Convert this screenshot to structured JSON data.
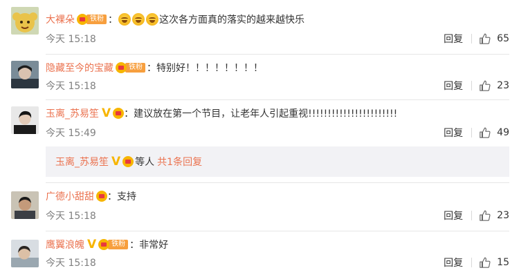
{
  "comments": [
    {
      "user": "大裸朵",
      "badge": "铁粉",
      "emoji_count": 3,
      "text": "这次各方面真的落实的越来越快乐",
      "time": "今天 15:18",
      "reply": "回复",
      "likes": "65"
    },
    {
      "user": "隐藏至今的宝藏",
      "badge": "铁粉",
      "text": "特别好！！！！！！！！",
      "time": "今天 15:18",
      "reply": "回复",
      "likes": "23"
    },
    {
      "user": "玉离_苏易笙",
      "text": "建议放在第一个节目，让老年人引起重视!!!!!!!!!!!!!!!!!!!!!!!",
      "time": "今天 15:49",
      "reply": "回复",
      "likes": "49"
    },
    {
      "user": "广德小甜甜",
      "text": "支持",
      "time": "今天 15:18",
      "reply": "回复",
      "likes": "23"
    },
    {
      "user": "鹰翼浪魄",
      "badge": "铁粉",
      "text": "非常好",
      "time": "今天 15:18",
      "reply": "回复",
      "likes": "15"
    }
  ],
  "sub_reply": {
    "user": "玉离_苏易笙",
    "etc": "等人",
    "total": "共1条回复"
  },
  "icons": {
    "like": "thumbs-up-icon",
    "verified": "v-mark-icon",
    "member": "crown-icon"
  },
  "colors": {
    "username": "#eb7350",
    "text": "#333333",
    "meta": "#808080",
    "badge": "#f79f3e",
    "subreply_bg": "#f2f2f5"
  }
}
